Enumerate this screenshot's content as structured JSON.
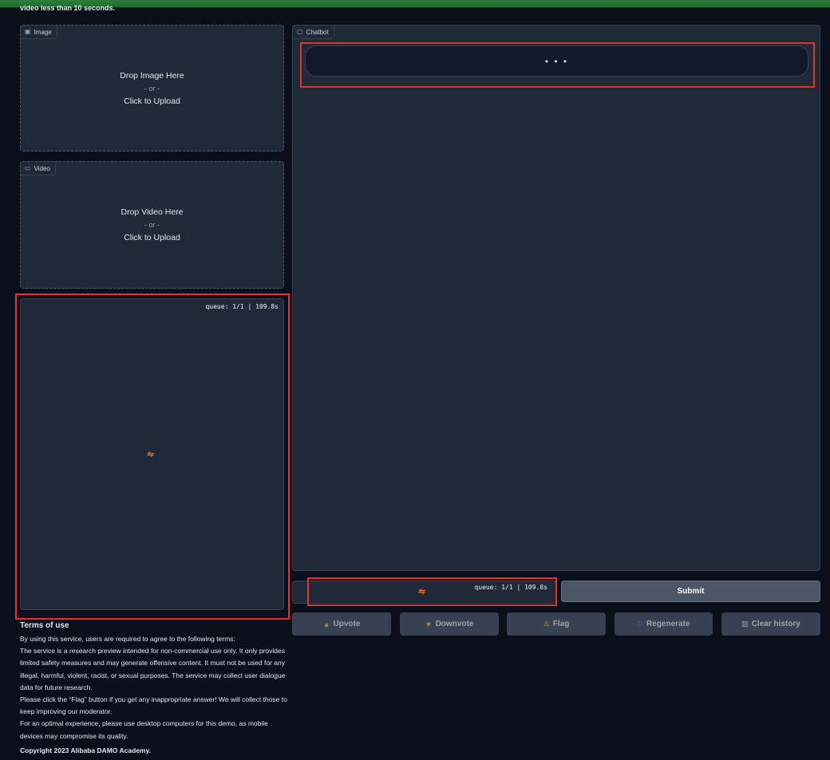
{
  "header": {
    "intro": "video less than 10 seconds."
  },
  "image_upload": {
    "label": "Image",
    "icon": "image-icon",
    "drop_text": "Drop Image Here",
    "or_text": "- or -",
    "click_text": "Click to Upload"
  },
  "video_upload": {
    "label": "Video",
    "icon": "video-icon",
    "drop_text": "Drop Video Here",
    "or_text": "- or -",
    "click_text": "Click to Upload"
  },
  "output_panel": {
    "queue_status": "queue: 1/1 | 109.8s",
    "spinner_icon": "loading-icon"
  },
  "chatbot": {
    "label": "Chatbot",
    "icon": "chat-icon",
    "pending_text": "• • •"
  },
  "input_box": {
    "queue_status": "queue: 1/1 | 109.8s",
    "spinner_icon": "loading-icon"
  },
  "buttons": {
    "submit": "Submit",
    "upvote": "Upvote",
    "downvote": "Downvote",
    "flag": "Flag",
    "regenerate": "Regenerate",
    "clear_history": "Clear history"
  },
  "terms": {
    "title": "Terms of use",
    "lines": [
      "By using this service, users are required to agree to the following terms:",
      "The service is a research preview intended for non-commercial use only. It only provides limited safety measures and may generate offensive content. It must not be used for any illegal, harmful, violent, racist, or sexual purposes. The service may collect user dialogue data for future research.",
      "Please click the “Flag” button if you get any inappropriate answer! We will collect those to keep improving our moderator.",
      "For an optimal experience, please use desktop computers for this demo, as mobile devices may compromise its quality."
    ],
    "copyright": "Copyright 2023 Alibaba DAMO Academy."
  },
  "colors": {
    "accent_spinner": "#f97316",
    "highlight_box": "#e0352b",
    "panel_bg": "#1f2937",
    "page_bg": "#0b0f19"
  }
}
